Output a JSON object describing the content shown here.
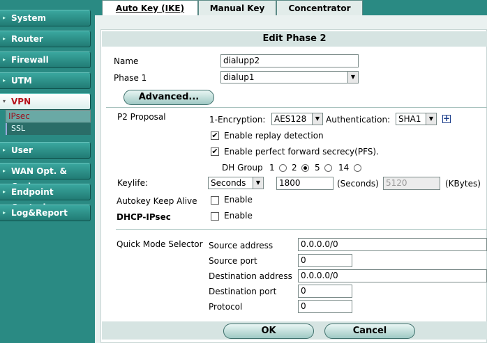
{
  "sidebar": {
    "items": [
      {
        "label": "System"
      },
      {
        "label": "Router"
      },
      {
        "label": "Firewall"
      },
      {
        "label": "UTM"
      },
      {
        "label": "VPN"
      },
      {
        "label": "User"
      },
      {
        "label": "WAN Opt. & Cache"
      },
      {
        "label": "Endpoint Control"
      },
      {
        "label": "Log&Report"
      }
    ],
    "vpn_subitems": [
      {
        "label": "IPsec"
      },
      {
        "label": "SSL"
      }
    ]
  },
  "tabs": [
    {
      "label": "Auto Key (IKE)"
    },
    {
      "label": "Manual Key"
    },
    {
      "label": "Concentrator"
    }
  ],
  "form": {
    "header": "Edit Phase 2",
    "name_label": "Name",
    "name_value": "dialupp2",
    "phase1_label": "Phase 1",
    "phase1_value": "dialup1",
    "advanced_label": "Advanced...",
    "p2_proposal_label": "P2 Proposal",
    "encryption_label": "1-Encryption:",
    "encryption_value": "AES128",
    "authentication_label": "Authentication:",
    "authentication_value": "SHA1",
    "replay_label": "Enable replay detection",
    "replay_checked": true,
    "pfs_label": "Enable perfect forward secrecy(PFS).",
    "pfs_checked": true,
    "dh_group_label": "DH Group",
    "dh_options": [
      "1",
      "2",
      "5",
      "14"
    ],
    "dh_selected": "5",
    "keylife_label": "Keylife:",
    "keylife_type": "Seconds",
    "keylife_seconds": "1800",
    "seconds_unit": "(Seconds)",
    "keylife_kbytes": "5120",
    "kbytes_unit": "(KBytes)",
    "autokey_label": "Autokey Keep Alive",
    "autokey_enable": "Enable",
    "dhcp_label": "DHCP-IPsec",
    "dhcp_enable": "Enable",
    "qms_label": "Quick Mode Selector",
    "source_address_label": "Source address",
    "source_address_value": "0.0.0.0/0",
    "source_port_label": "Source port",
    "source_port_value": "0",
    "dest_address_label": "Destination address",
    "dest_address_value": "0.0.0.0/0",
    "dest_port_label": "Destination port",
    "dest_port_value": "0",
    "protocol_label": "Protocol",
    "protocol_value": "0",
    "ok_label": "OK",
    "cancel_label": "Cancel"
  },
  "colors": {
    "sidebar": "#2a8a83",
    "active_nav_text": "#b5121b",
    "header_band": "#d6e4e2"
  },
  "icons": {
    "nav_arrow": "triangle-right-icon",
    "vpn_arrow": "triangle-down-icon",
    "dropdown": "chevron-down-icon",
    "plus": "plus-icon"
  }
}
